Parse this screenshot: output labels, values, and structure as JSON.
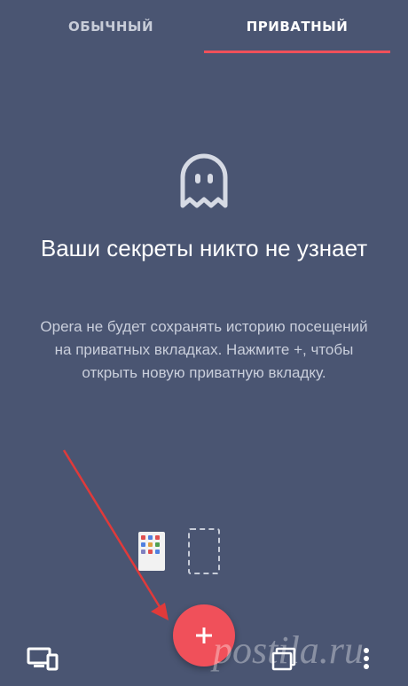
{
  "tabs": {
    "normal_label": "ОБЫЧНЫЙ",
    "private_label": "ПРИВАТНЫЙ",
    "active": "private"
  },
  "empty_state": {
    "icon": "ghost-icon",
    "headline": "Ваши секреты никто не узнает",
    "description": "Opera не будет сохранять историю посещений на приватных вкладках. Нажмите +, чтобы открыть новую приватную вкладку."
  },
  "fab": {
    "label": "+"
  },
  "bottom_bar": {
    "icons": [
      "devices-icon",
      "tabs-icon",
      "more-vert-icon"
    ]
  },
  "watermark": "postila.ru",
  "colors": {
    "background": "#4a5572",
    "accent": "#f0505a",
    "text_primary": "#ffffff",
    "text_secondary": "#c9cedb"
  }
}
